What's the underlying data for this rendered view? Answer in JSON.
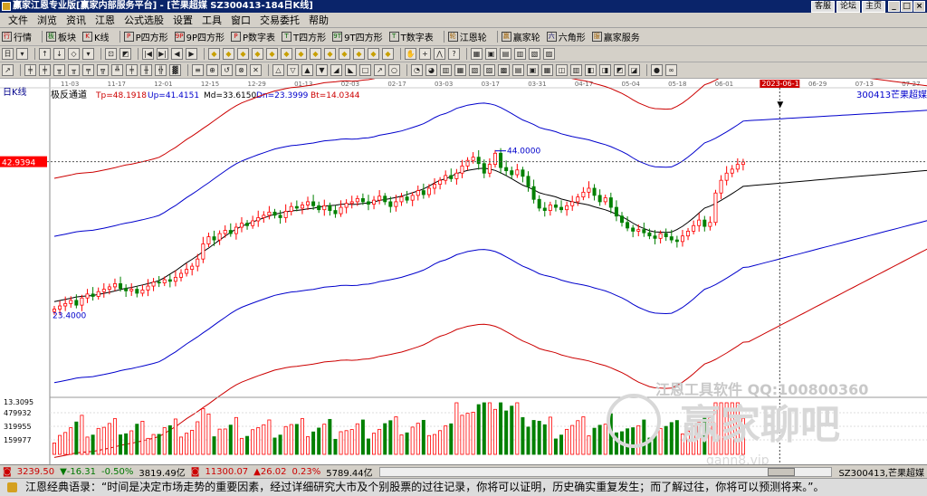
{
  "window": {
    "title": "赢家江恩专业版[赢家内部服务平台] - [芒果超媒  SZ300413-184日K线]",
    "links": [
      "客服",
      "论坛",
      "主页"
    ],
    "min": "_",
    "max": "□",
    "close": "×"
  },
  "menu": [
    "文件",
    "浏览",
    "资讯",
    "江恩",
    "公式选股",
    "设置",
    "工具",
    "窗口",
    "交易委托",
    "帮助"
  ],
  "toolbar1": [
    "行情",
    "板块",
    "K线",
    "P四方形",
    "9P四方形",
    "P数字表",
    "T四方形",
    "9T四方形",
    "T数字表",
    "江恩轮",
    "赢家轮",
    "六角形",
    "赢家服务"
  ],
  "toolbar1_icons": [
    "行",
    "板",
    "K",
    "P",
    "9P",
    "P",
    "T",
    "9T",
    "T",
    "轮",
    "赢",
    "六",
    "服"
  ],
  "toolbar2_icons": [
    "日",
    "▾",
    "↑",
    "↓",
    "◇",
    "▾",
    "⊡",
    "◩",
    "|◀",
    "▶|",
    "◀",
    "▶",
    "◆",
    "◆",
    "◆",
    "◆",
    "◆",
    "◆",
    "◆",
    "◆",
    "◆",
    "◆",
    "◆",
    "◆",
    "◆",
    "✋",
    "+",
    "⋀",
    "?",
    "▦",
    "▣",
    "▤",
    "▥",
    "▧",
    "▨"
  ],
  "toolbar3_icons": [
    "↗",
    "╪",
    "╪",
    "╥",
    "╥",
    "╤",
    "╦",
    "╩",
    "╪",
    "╫",
    "╬",
    "▓",
    "≡",
    "⊕",
    "↺",
    "⊗",
    "✕",
    "△",
    "▽",
    "▲",
    "▼",
    "◢",
    "◣",
    "□",
    "↗",
    "○",
    "◔",
    "◕",
    "▥",
    "▦",
    "▧",
    "▨",
    "▩",
    "▤",
    "▣",
    "▦",
    "◫",
    "▥",
    "◧",
    "◨",
    "◩",
    "◪",
    "●",
    "∞"
  ],
  "chart": {
    "period": "日K线",
    "indicator_name": "极反通道",
    "indicators": [
      {
        "label": "Tp=48.1918",
        "color": "#cc0000"
      },
      {
        "label": "Up=41.4151",
        "color": "#0000cc"
      },
      {
        "label": "Md=33.6150",
        "color": "#000000"
      },
      {
        "label": "Dn=23.3999",
        "color": "#0000cc"
      },
      {
        "label": "Bt=14.0344",
        "color": "#cc0000"
      }
    ],
    "stock_code": "300413",
    "stock_name": "芒果超媒",
    "price_tag": "42.9394",
    "high_label": "44.0000",
    "low_label": "23.4000",
    "date_ticks": [
      "11-03",
      "11-17",
      "12-01",
      "12-15",
      "12-29",
      "01-13",
      "02-03",
      "02-17",
      "03-03",
      "03-17",
      "03-31",
      "04-17",
      "05-04",
      "05-18",
      "06-01",
      "2023-06-12",
      "06-29",
      "07-13",
      "07-27"
    ],
    "volume_labels": [
      "13.3095",
      "479932",
      "319955",
      "159977"
    ],
    "watermark_software": "江恩工具软件  QQ:100800360",
    "watermark_brand": "赢家聊吧",
    "watermark_site": "gann8.vip",
    "colors": {
      "up": "#ff0000",
      "down": "#008000",
      "tp": "#cc0000",
      "up_band": "#0000cc",
      "md": "#000000",
      "dn_band": "#0000cc",
      "bt": "#cc0000",
      "price_tag_bg": "#ff0000"
    }
  },
  "chart_data": {
    "type": "candlestick",
    "x_start": "2022-11-01",
    "x_end": "2023-07-31",
    "ylim": [
      13.3095,
      52
    ],
    "price_series": [
      24.4,
      24.8,
      25.1,
      25.5,
      24.9,
      25.8,
      26.3,
      26.0,
      26.6,
      26.9,
      27.2,
      27.6,
      27.0,
      26.7,
      26.9,
      26.4,
      26.8,
      27.3,
      27.8,
      27.7,
      28.1,
      27.9,
      28.4,
      28.9,
      29.4,
      29.8,
      30.7,
      32.6,
      33.5,
      33.1,
      33.9,
      34.3,
      33.9,
      34.7,
      35.2,
      34.9,
      35.5,
      35.9,
      36.2,
      36.6,
      36.2,
      35.9,
      36.7,
      37.3,
      37.1,
      37.5,
      37.9,
      37.4,
      36.9,
      37.4,
      36.8,
      36.4,
      37.2,
      37.7,
      37.9,
      38.3,
      37.9,
      37.6,
      38.1,
      38.6,
      37.9,
      37.3,
      37.9,
      38.5,
      38.1,
      38.7,
      39.3,
      38.8,
      39.6,
      40.1,
      40.6,
      41.2,
      40.8,
      41.5,
      42.4,
      43.1,
      43.5,
      42.7,
      41.5,
      42.6,
      44.0,
      42.2,
      41.8,
      41.3,
      41.9,
      41.1,
      39.8,
      38.2,
      37.1,
      36.8,
      37.5,
      37.2,
      36.9,
      37.4,
      37.9,
      38.5,
      39.1,
      39.6,
      38.7,
      37.9,
      38.4,
      37.2,
      36.1,
      35.3,
      34.6,
      34.2,
      34.4,
      34.0,
      33.6,
      33.3,
      33.9,
      33.5,
      33.1,
      32.9,
      33.6,
      34.2,
      34.9,
      35.6,
      34.8,
      35.3,
      39.0,
      40.6,
      41.5,
      42.0,
      42.6,
      42.9
    ]
  },
  "status": {
    "idx1_val": "3239.50",
    "idx1_chg": "▼-16.31",
    "idx1_pct": "-0.50%",
    "idx1_amt": "3819.49亿",
    "idx2_val": "11300.07",
    "idx2_chg": "▲26.02",
    "idx2_pct": "0.23%",
    "idx2_amt": "5789.44亿",
    "right": "SZ300413,芒果超媒"
  },
  "quote": "江恩经典语录：“时间是决定市场走势的重要因素，经过详细研究大市及个别股票的过往记录，你将可以证明，历史确实重复发生；而了解过往，你将可以预测将来。”。"
}
